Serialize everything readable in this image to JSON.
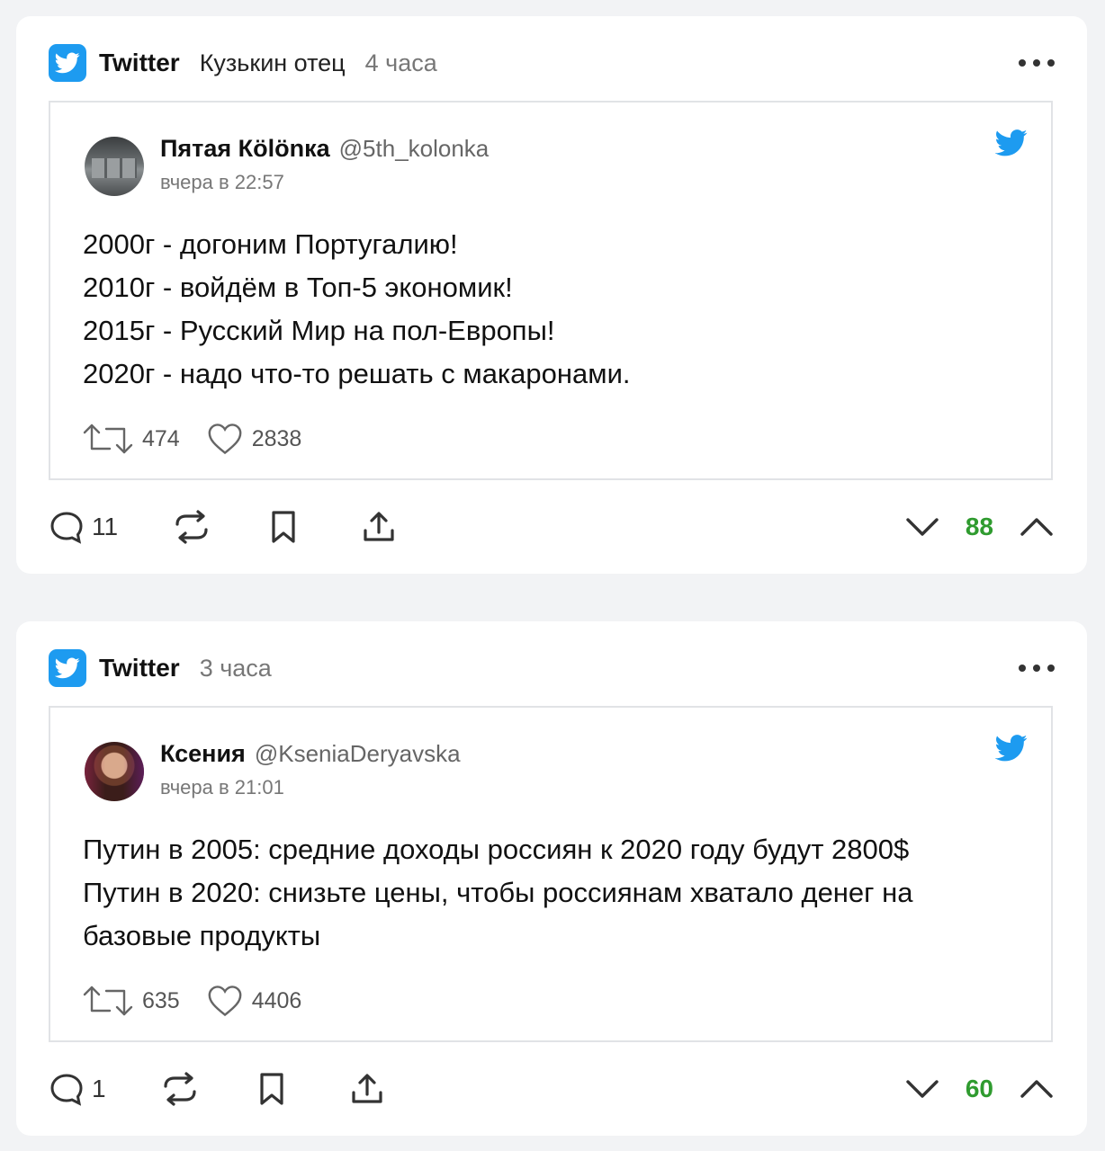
{
  "posts": [
    {
      "source": "Twitter",
      "author": "Кузькин отец",
      "time_ago": "4 часа",
      "tweet": {
        "name": "Пятая Кölönка",
        "handle": "@5th_kolonka",
        "date": "вчера в 22:57",
        "lines": [
          "2000г - догоним Португалию!",
          "2010г - войдём в Топ-5 экономик!",
          "2015г - Русский Мир на пол-Европы!",
          "2020г - надо что-то решать с макаронами."
        ],
        "retweets": "474",
        "likes": "2838"
      },
      "comments": "11",
      "rating": "88"
    },
    {
      "source": "Twitter",
      "author": "",
      "time_ago": "3 часа",
      "tweet": {
        "name": "Ксения",
        "handle": "@KseniaDeryavska",
        "date": "вчера в 21:01",
        "lines": [
          "Путин в 2005: средние доходы россиян к 2020 году будут 2800$",
          "Путин в 2020: снизьте цены, чтобы россиянам хватало денег на базовые продукты"
        ],
        "retweets": "635",
        "likes": "4406"
      },
      "comments": "1",
      "rating": "60"
    }
  ],
  "colors": {
    "twitter_blue": "#1d9bf0",
    "rating_green": "#2f9b2f",
    "page_bg": "#f2f3f5"
  },
  "icons": [
    "twitter-icon",
    "more-icon",
    "comment-icon",
    "repost-icon",
    "bookmark-icon",
    "share-icon",
    "downvote-icon",
    "upvote-icon",
    "retweet-icon",
    "heart-icon"
  ]
}
